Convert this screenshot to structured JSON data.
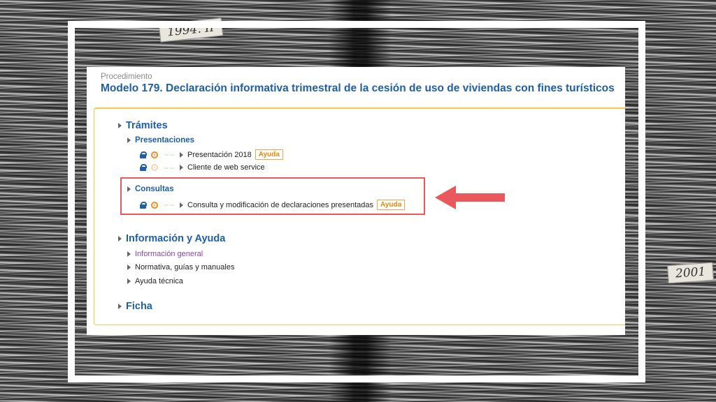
{
  "background": {
    "tags": [
      "1994. II",
      "2001",
      ""
    ]
  },
  "page": {
    "procedure_label": "Procedimiento",
    "title": "Modelo 179. Declaración informativa trimestral de la cesión de uso de viviendas con fines turísticos",
    "sections": {
      "tramites": {
        "label": "Trámites",
        "presentaciones": {
          "label": "Presentaciones",
          "items": [
            {
              "label": "Presentación 2018",
              "help": "Ayuda"
            },
            {
              "label": "Cliente de web service"
            }
          ]
        },
        "consultas": {
          "label": "Consultas",
          "items": [
            {
              "label": "Consulta y modificación de declaraciones presentadas",
              "help": "Ayuda"
            }
          ]
        }
      },
      "info": {
        "label": "Información y Ayuda",
        "items": [
          {
            "label": "Información general"
          },
          {
            "label": "Normativa, guías y manuales"
          },
          {
            "label": "Ayuda técnica"
          }
        ]
      },
      "ficha": {
        "label": "Ficha"
      }
    }
  },
  "colors": {
    "link_blue": "#1f5fa8",
    "accent_orange": "#e08a10",
    "highlight_red": "#e8585d",
    "box_border": "#f2c94c"
  },
  "icons": [
    "lock-icon",
    "certificate-icon",
    "pin-icon",
    "triangle-bullet-icon",
    "arrow-left-icon"
  ]
}
